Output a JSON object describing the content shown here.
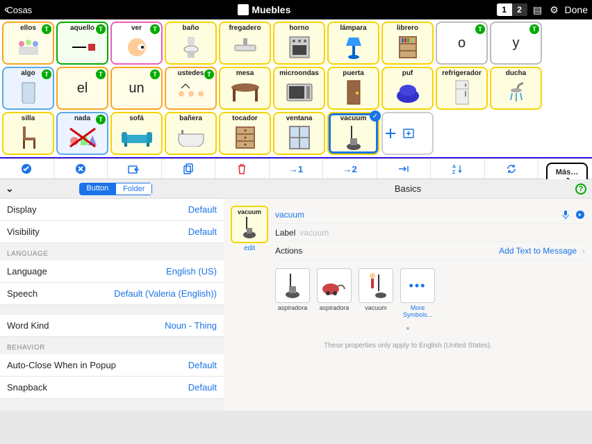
{
  "topbar": {
    "back": "Cosas",
    "title": "Muebles",
    "page_active": "1",
    "page_inactive": "2",
    "done": "Done"
  },
  "grid": [
    {
      "label": "ellos",
      "cls": "orange",
      "t": true,
      "icon": "people"
    },
    {
      "label": "aquello",
      "cls": "green",
      "t": true,
      "icon": "point"
    },
    {
      "label": "ver",
      "cls": "pink",
      "t": true,
      "icon": "eye"
    },
    {
      "label": "baño",
      "cls": "yellow",
      "icon": "toilet"
    },
    {
      "label": "fregadero",
      "cls": "yellow",
      "icon": "sink"
    },
    {
      "label": "horno",
      "cls": "yellow",
      "icon": "oven"
    },
    {
      "label": "lámpara",
      "cls": "yellow",
      "icon": "lamp"
    },
    {
      "label": "librero",
      "cls": "yellow",
      "icon": "bookshelf"
    },
    {
      "label": "o",
      "cls": "gray",
      "t": true,
      "big": true
    },
    {
      "label": "y",
      "cls": "gray",
      "t": true,
      "big": true
    },
    {
      "label": "algo",
      "cls": "blue",
      "t": true,
      "icon": "glass"
    },
    {
      "label": "el",
      "cls": "orange",
      "t": true,
      "big": true
    },
    {
      "label": "un",
      "cls": "orange",
      "t": true,
      "big": true
    },
    {
      "label": "ustedes",
      "cls": "orange",
      "t": true,
      "icon": "you-pl"
    },
    {
      "label": "mesa",
      "cls": "yellow",
      "icon": "table"
    },
    {
      "label": "microondas",
      "cls": "yellow",
      "icon": "microwave"
    },
    {
      "label": "puerta",
      "cls": "yellow",
      "icon": "door"
    },
    {
      "label": "puf",
      "cls": "yellow",
      "icon": "beanbag"
    },
    {
      "label": "refrigerador",
      "cls": "yellow",
      "icon": "fridge"
    },
    {
      "label": "ducha",
      "cls": "yellow",
      "icon": "shower"
    },
    {
      "label": "silla",
      "cls": "yellow",
      "icon": "chair"
    },
    {
      "label": "nada",
      "cls": "blue",
      "t": true,
      "icon": "no-shapes"
    },
    {
      "label": "sofá",
      "cls": "yellow",
      "icon": "sofa"
    },
    {
      "label": "bañera",
      "cls": "yellow",
      "icon": "bathtub"
    },
    {
      "label": "tocador",
      "cls": "yellow",
      "icon": "dresser"
    },
    {
      "label": "ventana",
      "cls": "yellow",
      "icon": "window"
    },
    {
      "label": "vacuum",
      "cls": "yellow",
      "icon": "vacuum",
      "check": true,
      "selected": true
    }
  ],
  "mas": "Más…",
  "seg": {
    "a": "Button",
    "b": "Folder"
  },
  "left": [
    {
      "k": "Display",
      "v": "Default"
    },
    {
      "k": "Visibility",
      "v": "Default"
    },
    {
      "sec": "LANGUAGE"
    },
    {
      "k": "Language",
      "v": "English (US)"
    },
    {
      "k": "Speech",
      "v": "Default (Valeria (English))"
    },
    {
      "sec": ""
    },
    {
      "k": "Word Kind",
      "v": "Noun - Thing"
    },
    {
      "sec": "BEHAVIOR"
    },
    {
      "k": "Auto-Close When in Popup",
      "v": "Default"
    },
    {
      "k": "Snapback",
      "v": "Default"
    }
  ],
  "right": {
    "head": "Basics",
    "name": "vacuum",
    "edit": "edit",
    "label_key": "Label",
    "label_ph": "vacuum",
    "actions_key": "Actions",
    "actions_link": "Add Text to Message",
    "symbols": [
      {
        "label": "aspiradora",
        "icon": "vac1"
      },
      {
        "label": "aspiradora",
        "icon": "vac2"
      },
      {
        "label": "vacuum",
        "icon": "vac3"
      },
      {
        "label": "More Symbols...",
        "more": true
      }
    ],
    "foot": "These properties only apply to English (United States)."
  },
  "tool_labels": {
    "t1": "→1",
    "t2": "→2"
  }
}
